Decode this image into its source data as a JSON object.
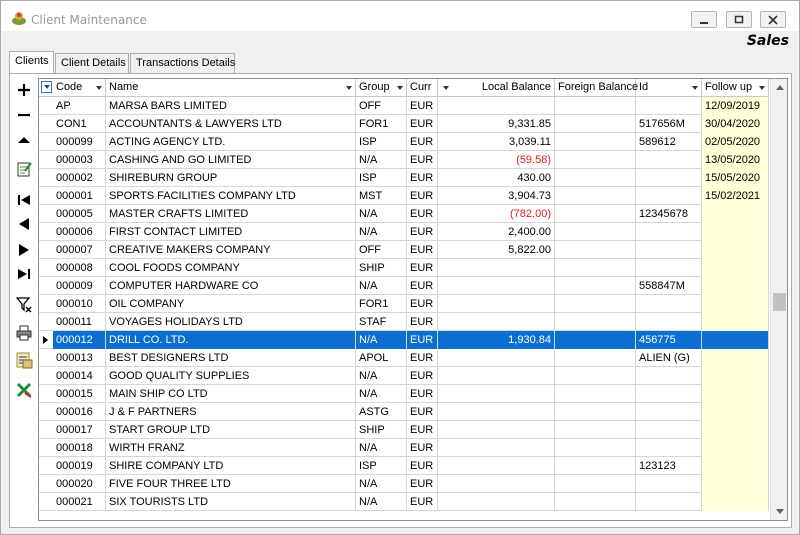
{
  "window": {
    "title": "Client Maintenance",
    "brand": "Sales"
  },
  "tabs": [
    {
      "label": "Clients",
      "active": true
    },
    {
      "label": "Client Details",
      "active": false
    },
    {
      "label": "Transactions Details",
      "active": false
    }
  ],
  "toolbar": [
    {
      "name": "add-record-icon"
    },
    {
      "name": "delete-record-icon"
    },
    {
      "name": "move-up-icon"
    },
    {
      "name": "edit-record-icon"
    },
    {
      "name": "first-record-icon"
    },
    {
      "name": "previous-record-icon"
    },
    {
      "name": "next-record-icon"
    },
    {
      "name": "last-record-icon"
    },
    {
      "name": "filter-icon"
    },
    {
      "name": "print-icon"
    },
    {
      "name": "report-icon"
    },
    {
      "name": "export-excel-icon"
    }
  ],
  "columns": {
    "code": "Code",
    "name": "Name",
    "group": "Group",
    "curr": "Curr",
    "local_balance": "Local Balance",
    "foreign_balance": "Foreign Balance",
    "id": "Id",
    "follow_up": "Follow up"
  },
  "rows": [
    {
      "code": "AP",
      "name": "MARSA BARS LIMITED",
      "group": "OFF",
      "curr": "EUR",
      "local_balance": "",
      "foreign_balance": "",
      "id": "",
      "follow_up": "12/09/2019",
      "negative": false
    },
    {
      "code": "CON1",
      "name": "ACCOUNTANTS & LAWYERS LTD",
      "group": "FOR1",
      "curr": "EUR",
      "local_balance": "9,331.85",
      "foreign_balance": "",
      "id": "517656M",
      "follow_up": "30/04/2020",
      "negative": false
    },
    {
      "code": "000099",
      "name": "ACTING AGENCY LTD.",
      "group": "ISP",
      "curr": "EUR",
      "local_balance": "3,039.11",
      "foreign_balance": "",
      "id": "589612",
      "follow_up": "02/05/2020",
      "negative": false
    },
    {
      "code": "000003",
      "name": "CASHING AND GO LIMITED",
      "group": "N/A",
      "curr": "EUR",
      "local_balance": "(59.58)",
      "foreign_balance": "",
      "id": "",
      "follow_up": "13/05/2020",
      "negative": true
    },
    {
      "code": "000002",
      "name": "SHIREBURN GROUP",
      "group": "ISP",
      "curr": "EUR",
      "local_balance": "430.00",
      "foreign_balance": "",
      "id": "",
      "follow_up": "15/05/2020",
      "negative": false
    },
    {
      "code": "000001",
      "name": "SPORTS FACILITIES COMPANY LTD",
      "group": "MST",
      "curr": "EUR",
      "local_balance": "3,904.73",
      "foreign_balance": "",
      "id": "",
      "follow_up": "15/02/2021",
      "negative": false
    },
    {
      "code": "000005",
      "name": "MASTER CRAFTS LIMITED",
      "group": "N/A",
      "curr": "EUR",
      "local_balance": "(782.00)",
      "foreign_balance": "",
      "id": "12345678",
      "follow_up": "",
      "negative": true
    },
    {
      "code": "000006",
      "name": "FIRST CONTACT LIMITED",
      "group": "N/A",
      "curr": "EUR",
      "local_balance": "2,400.00",
      "foreign_balance": "",
      "id": "",
      "follow_up": "",
      "negative": false
    },
    {
      "code": "000007",
      "name": "CREATIVE MAKERS COMPANY",
      "group": "OFF",
      "curr": "EUR",
      "local_balance": "5,822.00",
      "foreign_balance": "",
      "id": "",
      "follow_up": "",
      "negative": false
    },
    {
      "code": "000008",
      "name": "COOL FOODS COMPANY",
      "group": "SHIP",
      "curr": "EUR",
      "local_balance": "",
      "foreign_balance": "",
      "id": "",
      "follow_up": "",
      "negative": false
    },
    {
      "code": "000009",
      "name": "COMPUTER HARDWARE CO",
      "group": "N/A",
      "curr": "EUR",
      "local_balance": "",
      "foreign_balance": "",
      "id": "558847M",
      "follow_up": "",
      "negative": false
    },
    {
      "code": "000010",
      "name": "OIL COMPANY",
      "group": "FOR1",
      "curr": "EUR",
      "local_balance": "",
      "foreign_balance": "",
      "id": "",
      "follow_up": "",
      "negative": false
    },
    {
      "code": "000011",
      "name": "VOYAGES HOLIDAYS LTD",
      "group": "STAF",
      "curr": "EUR",
      "local_balance": "",
      "foreign_balance": "",
      "id": "",
      "follow_up": "",
      "negative": false
    },
    {
      "code": "000012",
      "name": "DRILL CO. LTD.",
      "group": "N/A",
      "curr": "EUR",
      "local_balance": "1,930.84",
      "foreign_balance": "",
      "id": "456775",
      "follow_up": "",
      "negative": false,
      "selected": true
    },
    {
      "code": "000013",
      "name": "BEST DESIGNERS LTD",
      "group": "APOL",
      "curr": "EUR",
      "local_balance": "",
      "foreign_balance": "",
      "id": "ALIEN (G)",
      "follow_up": "",
      "negative": false
    },
    {
      "code": "000014",
      "name": "GOOD QUALITY SUPPLIES",
      "group": "N/A",
      "curr": "EUR",
      "local_balance": "",
      "foreign_balance": "",
      "id": "",
      "follow_up": "",
      "negative": false
    },
    {
      "code": "000015",
      "name": "MAIN SHIP CO LTD",
      "group": "N/A",
      "curr": "EUR",
      "local_balance": "",
      "foreign_balance": "",
      "id": "",
      "follow_up": "",
      "negative": false
    },
    {
      "code": "000016",
      "name": "J & F PARTNERS",
      "group": "ASTG",
      "curr": "EUR",
      "local_balance": "",
      "foreign_balance": "",
      "id": "",
      "follow_up": "",
      "negative": false
    },
    {
      "code": "000017",
      "name": "START GROUP LTD",
      "group": "SHIP",
      "curr": "EUR",
      "local_balance": "",
      "foreign_balance": "",
      "id": "",
      "follow_up": "",
      "negative": false
    },
    {
      "code": "000018",
      "name": "WIRTH FRANZ",
      "group": "N/A",
      "curr": "EUR",
      "local_balance": "",
      "foreign_balance": "",
      "id": "",
      "follow_up": "",
      "negative": false
    },
    {
      "code": "000019",
      "name": "SHIRE COMPANY LTD",
      "group": "ISP",
      "curr": "EUR",
      "local_balance": "",
      "foreign_balance": "",
      "id": "123123",
      "follow_up": "",
      "negative": false
    },
    {
      "code": "000020",
      "name": "FIVE FOUR THREE LTD",
      "group": "N/A",
      "curr": "EUR",
      "local_balance": "",
      "foreign_balance": "",
      "id": "",
      "follow_up": "",
      "negative": false
    },
    {
      "code": "000021",
      "name": "SIX TOURISTS LTD",
      "group": "N/A",
      "curr": "EUR",
      "local_balance": "",
      "foreign_balance": "",
      "id": "",
      "follow_up": "",
      "negative": false
    }
  ],
  "colors": {
    "selection": "#0a6fd0",
    "negative": "#e02020",
    "followup_bg": "#ffffd8"
  }
}
